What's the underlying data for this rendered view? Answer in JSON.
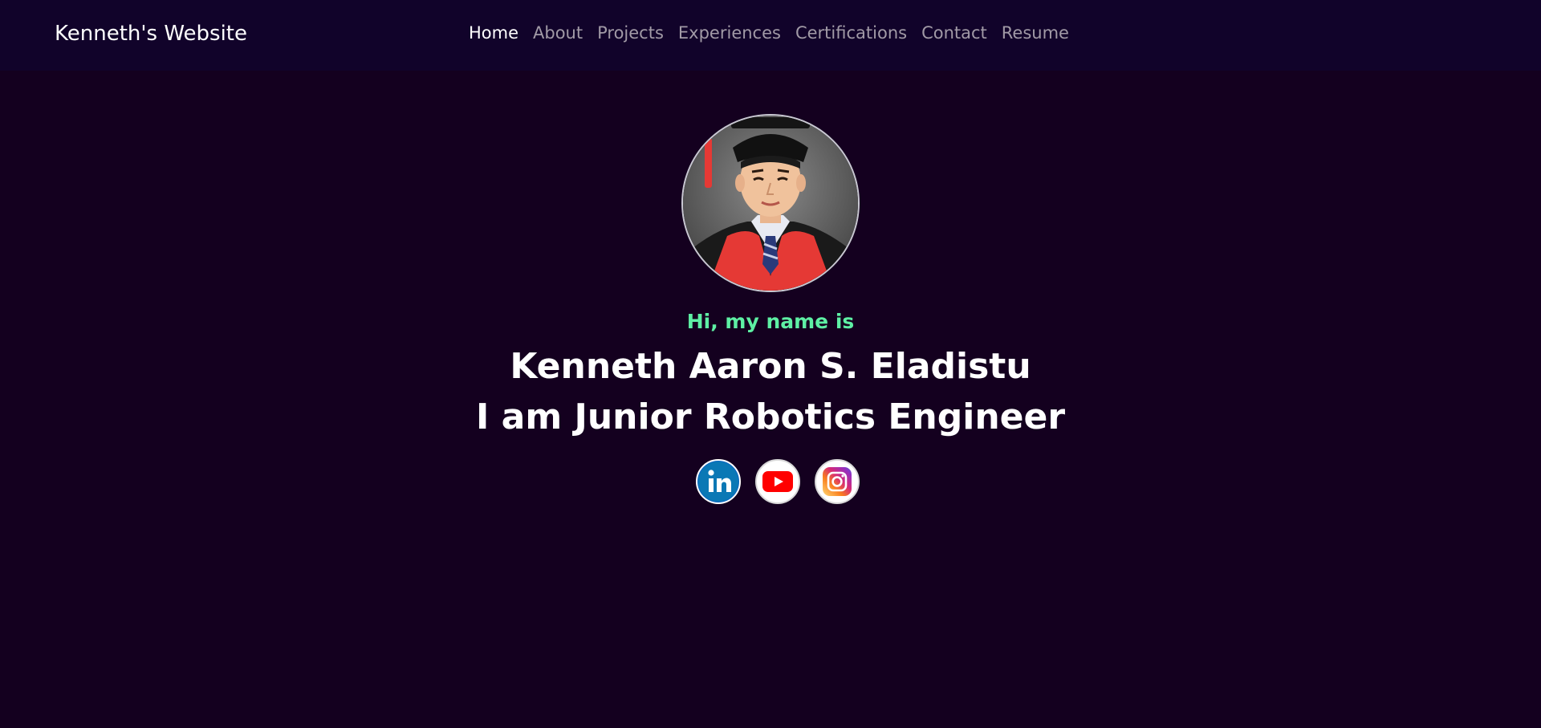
{
  "navbar": {
    "brand": "Kenneth's Website",
    "links": [
      {
        "label": "Home",
        "active": true
      },
      {
        "label": "About"
      },
      {
        "label": "Projects"
      },
      {
        "label": "Experiences"
      },
      {
        "label": "Certifications"
      },
      {
        "label": "Contact"
      },
      {
        "label": "Resume"
      }
    ]
  },
  "hero": {
    "greeting": "Hi, my name is",
    "name": "Kenneth Aaron S. Eladistu",
    "role": "I am Junior Robotics Engineer",
    "avatar_icon": "graduation-portrait",
    "social": [
      {
        "icon": "linkedin-icon",
        "color": "#0a66c2"
      },
      {
        "icon": "youtube-icon",
        "color": "#ff0000"
      },
      {
        "icon": "instagram-icon",
        "color": "#e1306c"
      }
    ]
  },
  "colors": {
    "background": "#14001f",
    "navbar": "#11032a",
    "accent": "#5ef0a4"
  }
}
